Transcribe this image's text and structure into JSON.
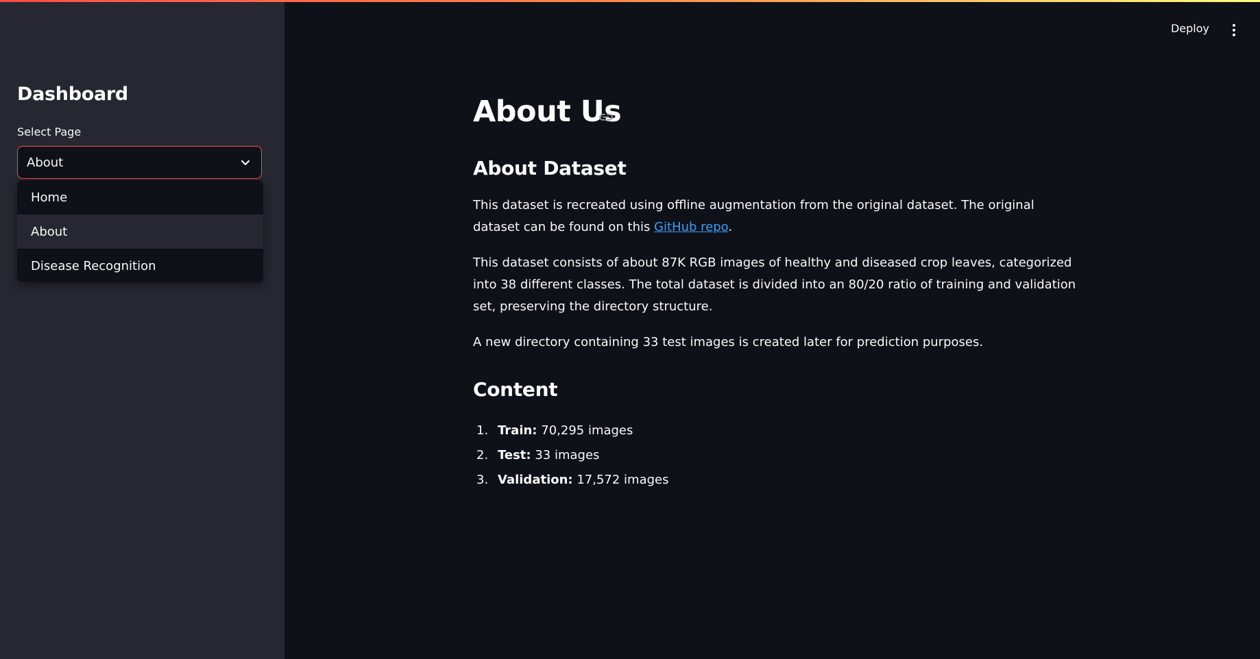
{
  "header": {
    "deploy_label": "Deploy",
    "menu_icon": "kebab-menu-icon"
  },
  "sidebar": {
    "title": "Dashboard",
    "select_label": "Select Page",
    "select_value": "About",
    "options": [
      "Home",
      "About",
      "Disease Recognition"
    ]
  },
  "main": {
    "title": "About Us",
    "dataset_heading": "About Dataset",
    "p1_before": "This dataset is recreated using offline augmentation from the original dataset. The original dataset can be found on this ",
    "p1_link": "GitHub repo",
    "p1_after": ".",
    "p2": "This dataset consists of about 87K RGB images of healthy and diseased crop leaves, categorized into 38 different classes. The total dataset is divided into an 80/20 ratio of training and validation set, preserving the directory structure.",
    "p3": "A new directory containing 33 test images is created later for prediction purposes.",
    "content_heading": "Content",
    "content_items": [
      {
        "num": "1.",
        "label": "Train:",
        "value": " 70,295 images"
      },
      {
        "num": "2.",
        "label": "Test:",
        "value": " 33 images"
      },
      {
        "num": "3.",
        "label": "Validation:",
        "value": " 17,572 images"
      }
    ]
  },
  "colors": {
    "accent": "#ff4b4b",
    "link": "#3d9df3",
    "background": "#0e1117",
    "sidebar": "#262730"
  }
}
